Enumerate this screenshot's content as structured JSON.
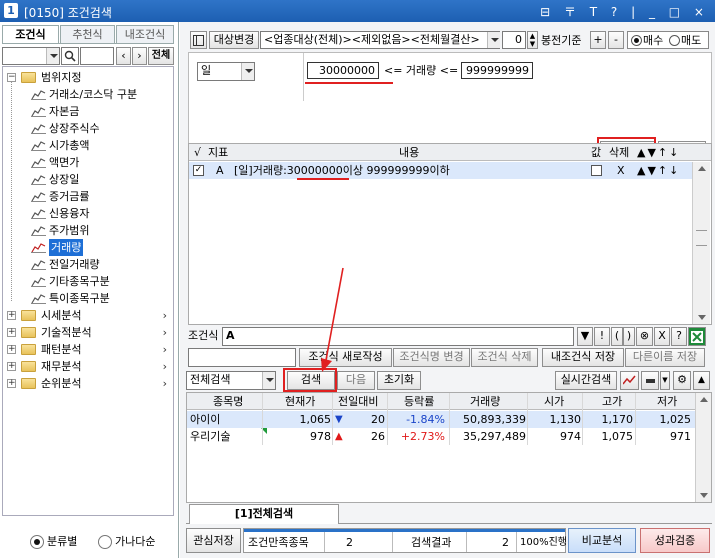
{
  "window": {
    "number": "1",
    "title": "[0150] 조건검색",
    "controls": "⊟ 〒 T ? | _ □ ×"
  },
  "left": {
    "tabs": [
      "조건식",
      "추천식",
      "내조건식"
    ],
    "search_btn": "전체",
    "tree": {
      "root": "범위지정",
      "children": [
        "거래소/코스닥 구분",
        "자본금",
        "상장주식수",
        "시가총액",
        "액면가",
        "상장일",
        "증거금률",
        "신용융자",
        "주가범위",
        "거래량",
        "전일거래량",
        "기타종목구분",
        "특이종목구분"
      ],
      "selected": "거래량",
      "folders": [
        "시세분석",
        "기술적분석",
        "패턴분석",
        "재무분석",
        "순위분석"
      ]
    },
    "radio": {
      "by_category": "분류별",
      "alphabetical": "가나다순"
    }
  },
  "toolbar": {
    "target_change": "대상변경",
    "target_text": "<업종대상(전체)><제외없음><전체월결산>",
    "bong_value": "0",
    "bong_label": "봉전기준",
    "plus": "+",
    "minus": "-",
    "buy": "매수",
    "sell": "매도"
  },
  "condition": {
    "period": "일",
    "min_value": "30000000",
    "op1": "<= 거래량 <=",
    "max_value": "999999999",
    "modify_btn": "수정",
    "add_btn": "추가"
  },
  "cond_table": {
    "headers": [
      "√",
      "지표",
      "내용",
      "값",
      "삭제",
      "▲▼↑↓"
    ],
    "rows": [
      {
        "check": "✓",
        "letter": "A",
        "content": "[일]거래량:30000000이상 999999999이하",
        "value": "",
        "del": "X",
        "arrows": "▲▼↑↓"
      }
    ]
  },
  "formula": {
    "label": "조건식",
    "value": "A",
    "buttons": [
      "▼",
      "!",
      "(",
      ")",
      "⊗",
      "X",
      "?"
    ]
  },
  "name_row": {
    "name_placeholder": "",
    "new_btn": "조건식 새로작성",
    "rename_btn": "조건식명 변경",
    "delete_btn": "조건식 삭제",
    "save_btn": "내조건식 저장",
    "saveas_btn": "다른이름 저장"
  },
  "search_row": {
    "scope": "전체검색",
    "search_btn": "검색",
    "next_btn": "다음",
    "reset_btn": "초기화",
    "realtime_btn": "실시간검색"
  },
  "results": {
    "headers": [
      "종목명",
      "현재가",
      "전일대비",
      "등락률",
      "거래량",
      "시가",
      "고가",
      "저가"
    ],
    "rows": [
      {
        "name": "아이이",
        "price": "1,065",
        "sign": "▼",
        "change": "20",
        "rate": "-1.84%",
        "volume": "50,893,339",
        "open": "1,130",
        "high": "1,170",
        "low": "1,025",
        "dir": "down"
      },
      {
        "name": "우리기술",
        "price": "978",
        "sign": "▲",
        "change": "26",
        "rate": "+2.73%",
        "volume": "35,297,489",
        "open": "974",
        "high": "1,075",
        "low": "971",
        "dir": "up"
      }
    ],
    "tab_label": "[1]전체검색"
  },
  "status": {
    "fav_save": "관심저장",
    "matched_label": "조건만족종목",
    "matched_value": "2",
    "result_label": "검색결과",
    "result_value": "2",
    "progress": "100%진행",
    "compare_btn": "비교분석",
    "performance_btn": "성과검증"
  },
  "colors": {
    "accent": "#1d5fb2",
    "down": "#1a44c8",
    "up": "#e01818",
    "highlight_box": "#e02020"
  }
}
